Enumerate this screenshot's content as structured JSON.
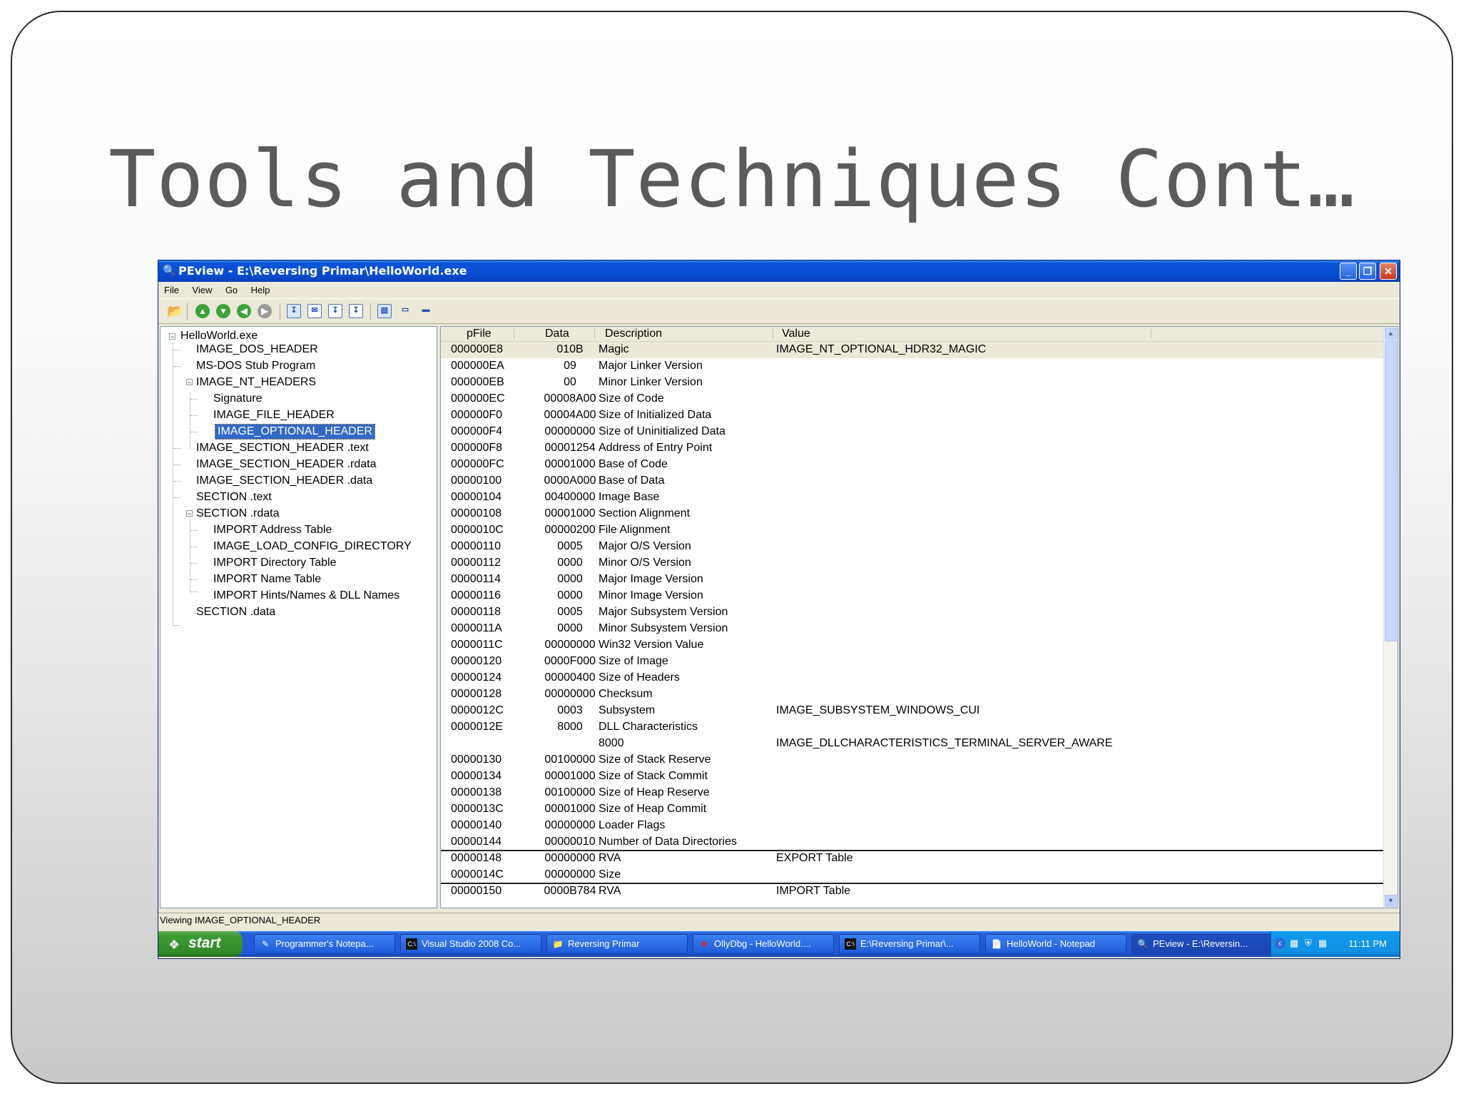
{
  "slide": {
    "title": "Tools and Techniques Cont…"
  },
  "window": {
    "title": "PEview - E:\\Reversing Primar\\HelloWorld.exe",
    "menu": [
      "File",
      "View",
      "Go",
      "Help"
    ],
    "status": "Viewing IMAGE_OPTIONAL_HEADER"
  },
  "tree": {
    "root": "HelloWorld.exe",
    "dos_header": "IMAGE_DOS_HEADER",
    "dos_stub": "MS-DOS Stub Program",
    "nt_headers": "IMAGE_NT_HEADERS",
    "signature": "Signature",
    "file_header": "IMAGE_FILE_HEADER",
    "optional_header": "IMAGE_OPTIONAL_HEADER",
    "sec_hdr_text": "IMAGE_SECTION_HEADER .text",
    "sec_hdr_rdata": "IMAGE_SECTION_HEADER .rdata",
    "sec_hdr_data": "IMAGE_SECTION_HEADER .data",
    "section_text": "SECTION .text",
    "section_rdata": "SECTION .rdata",
    "import_address_table": "IMPORT Address Table",
    "load_config": "IMAGE_LOAD_CONFIG_DIRECTORY",
    "import_directory_table": "IMPORT Directory Table",
    "import_name_table": "IMPORT Name Table",
    "import_hints": "IMPORT Hints/Names & DLL Names",
    "section_data": "SECTION .data"
  },
  "grid": {
    "headers": {
      "pfile": "pFile",
      "data": "Data",
      "description": "Description",
      "value": "Value"
    },
    "rows": [
      [
        "000000E8",
        "010B",
        "Magic",
        "IMAGE_NT_OPTIONAL_HDR32_MAGIC"
      ],
      [
        "000000EA",
        "09",
        "Major Linker Version",
        ""
      ],
      [
        "000000EB",
        "00",
        "Minor Linker Version",
        ""
      ],
      [
        "000000EC",
        "00008A00",
        "Size of Code",
        ""
      ],
      [
        "000000F0",
        "00004A00",
        "Size of Initialized Data",
        ""
      ],
      [
        "000000F4",
        "00000000",
        "Size of Uninitialized Data",
        ""
      ],
      [
        "000000F8",
        "00001254",
        "Address of Entry Point",
        ""
      ],
      [
        "000000FC",
        "00001000",
        "Base of Code",
        ""
      ],
      [
        "00000100",
        "0000A000",
        "Base of Data",
        ""
      ],
      [
        "00000104",
        "00400000",
        "Image Base",
        ""
      ],
      [
        "00000108",
        "00001000",
        "Section Alignment",
        ""
      ],
      [
        "0000010C",
        "00000200",
        "File Alignment",
        ""
      ],
      [
        "00000110",
        "0005",
        "Major O/S Version",
        ""
      ],
      [
        "00000112",
        "0000",
        "Minor O/S Version",
        ""
      ],
      [
        "00000114",
        "0000",
        "Major Image Version",
        ""
      ],
      [
        "00000116",
        "0000",
        "Minor Image Version",
        ""
      ],
      [
        "00000118",
        "0005",
        "Major Subsystem Version",
        ""
      ],
      [
        "0000011A",
        "0000",
        "Minor Subsystem Version",
        ""
      ],
      [
        "0000011C",
        "00000000",
        "Win32 Version Value",
        ""
      ],
      [
        "00000120",
        "0000F000",
        "Size of Image",
        ""
      ],
      [
        "00000124",
        "00000400",
        "Size of Headers",
        ""
      ],
      [
        "00000128",
        "00000000",
        "Checksum",
        ""
      ],
      [
        "0000012C",
        "0003",
        "Subsystem",
        "IMAGE_SUBSYSTEM_WINDOWS_CUI"
      ],
      [
        "0000012E",
        "8000",
        "DLL Characteristics",
        ""
      ],
      [
        "",
        "",
        "8000",
        "IMAGE_DLLCHARACTERISTICS_TERMINAL_SERVER_AWARE"
      ],
      [
        "00000130",
        "00100000",
        "Size of Stack Reserve",
        ""
      ],
      [
        "00000134",
        "00001000",
        "Size of Stack Commit",
        ""
      ],
      [
        "00000138",
        "00100000",
        "Size of Heap Reserve",
        ""
      ],
      [
        "0000013C",
        "00001000",
        "Size of Heap Commit",
        ""
      ],
      [
        "00000140",
        "00000000",
        "Loader Flags",
        ""
      ],
      [
        "00000144",
        "00000010",
        "Number of Data Directories",
        ""
      ],
      [
        "00000148",
        "00000000",
        "RVA",
        "EXPORT Table"
      ],
      [
        "0000014C",
        "00000000",
        "Size",
        ""
      ],
      [
        "00000150",
        "0000B784",
        "RVA",
        "IMPORT Table"
      ]
    ]
  },
  "taskbar": {
    "start": "start",
    "tasks": [
      "Programmer's Notepa...",
      "Visual Studio 2008 Co...",
      "Reversing Primar",
      "OllyDbg - HelloWorld....",
      "E:\\Reversing Primar\\...",
      "HelloWorld - Notepad",
      "PEview - E:\\Reversin..."
    ],
    "clock": "11:11 PM"
  }
}
